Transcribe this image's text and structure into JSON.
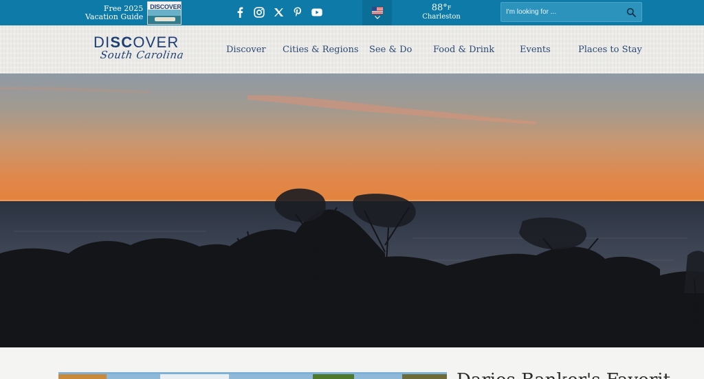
{
  "top_bar": {
    "guide_line1": "Free 2025",
    "guide_line2": "Vacation Guide",
    "guide_cover_logo": "DISCOVER",
    "social_icons": [
      "facebook-icon",
      "instagram-icon",
      "x-icon",
      "pinterest-icon",
      "youtube-icon"
    ],
    "language_flag": "us-flag-icon",
    "weather": {
      "temperature": "88°",
      "unit": "F",
      "city": "Charleston"
    },
    "search": {
      "placeholder": "I'm looking for ...",
      "value": ""
    }
  },
  "nav": {
    "logo": {
      "word_left": "DI",
      "word_mid": "SC",
      "word_right": "OVER",
      "script": "South Carolina"
    },
    "items": [
      "Discover",
      "Cities & Regions",
      "See & Do",
      "Food & Drink",
      "Events",
      "Places to Stay"
    ]
  },
  "feature": {
    "title_partial": "Daries Banker's Favorit"
  },
  "colors": {
    "top_bar": "#0d7aa8",
    "search_box": "#2c93bd",
    "brand_navy": "#1e3f73",
    "nav_text": "#2c4a72",
    "nav_background": "#ecebe8"
  }
}
